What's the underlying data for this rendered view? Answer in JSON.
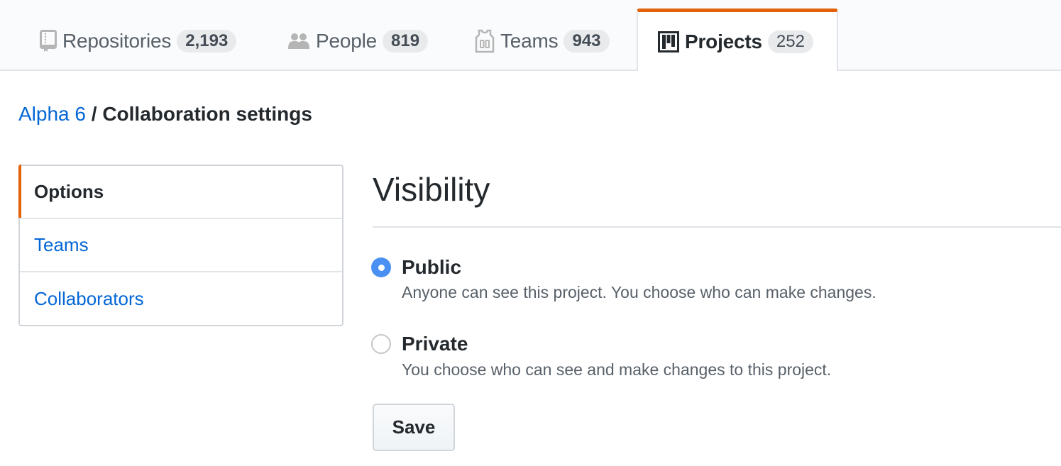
{
  "tabs": [
    {
      "label": "Repositories",
      "count": "2,193",
      "icon": "repo-icon",
      "selected": false
    },
    {
      "label": "People",
      "count": "819",
      "icon": "people-icon",
      "selected": false
    },
    {
      "label": "Teams",
      "count": "943",
      "icon": "jersey-icon",
      "selected": false
    },
    {
      "label": "Projects",
      "count": "252",
      "icon": "project-icon",
      "selected": true
    }
  ],
  "breadcrumb": {
    "parent": "Alpha 6",
    "separator": "/",
    "current": "Collaboration settings"
  },
  "menu": {
    "items": [
      {
        "label": "Options",
        "selected": true
      },
      {
        "label": "Teams",
        "selected": false
      },
      {
        "label": "Collaborators",
        "selected": false
      }
    ]
  },
  "visibility": {
    "heading": "Visibility",
    "options": [
      {
        "label": "Public",
        "note": "Anyone can see this project. You choose who can make changes.",
        "checked": true
      },
      {
        "label": "Private",
        "note": "You choose who can see and make changes to this project.",
        "checked": false
      }
    ],
    "save_label": "Save"
  },
  "colors": {
    "accent": "#e36209",
    "link": "#0366d6",
    "radio_checked": "#4a90f2"
  }
}
